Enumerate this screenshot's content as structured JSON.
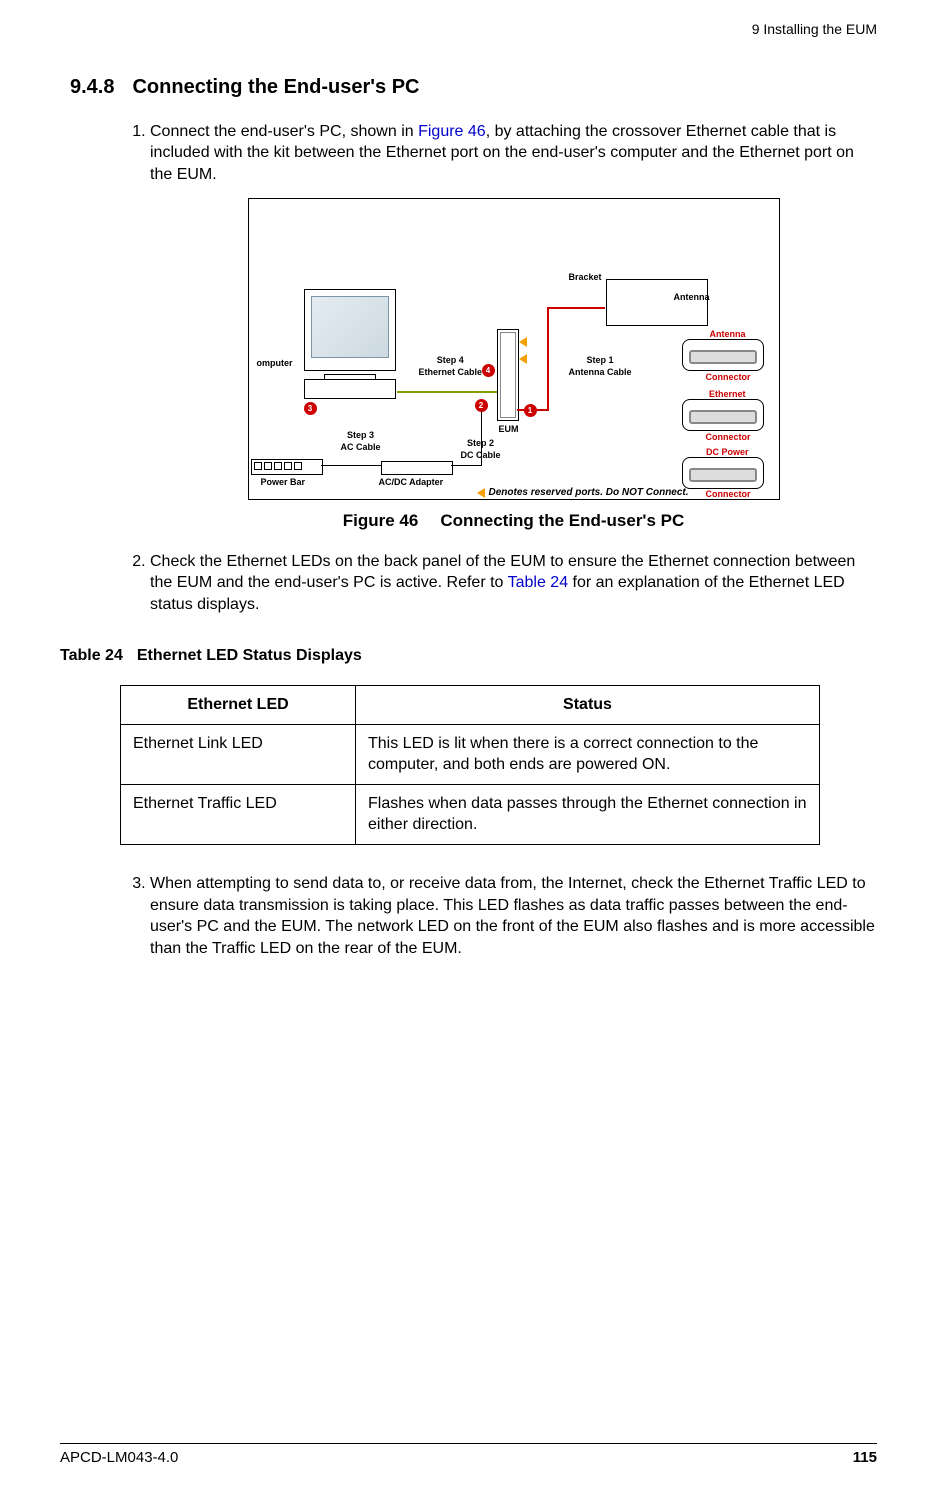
{
  "header": {
    "running": "9  Installing the EUM"
  },
  "section": {
    "number": "9.4.8",
    "title": "Connecting the End-user's PC"
  },
  "steps": {
    "s1_a": "Connect the end-user's PC, shown in ",
    "s1_link": "Figure 46",
    "s1_b": ", by attaching the crossover Ethernet cable that is included with the kit between the Ethernet port on the end-user's computer and the Ethernet port on the EUM.",
    "s2_a": "Check the Ethernet LEDs on the back panel of the EUM to ensure the Ethernet connection between the EUM and the end-user's PC is active. Refer to ",
    "s2_link": "Table 24",
    "s2_b": " for an explanation of the Ethernet LED status displays.",
    "s3": "When attempting to send data to, or receive data from, the Internet, check the Ethernet Traffic LED to ensure data transmission is taking place. This LED flashes as data traffic passes between the end-user's PC and the EUM. The network LED on the front of the EUM also flashes and is more accessible than the Traffic LED on the rear of the EUM."
  },
  "figure": {
    "num": "Figure 46",
    "title": "Connecting the End-user's PC",
    "labels": {
      "computer": "omputer",
      "powerbar": "Power Bar",
      "step3a": "Step 3",
      "step3b": "AC Cable",
      "adapter": "AC/DC Adapter",
      "step2a": "Step 2",
      "step2b": "DC Cable",
      "step4a": "Step 4",
      "step4b": "Ethernet Cable",
      "eum": "EUM",
      "step1a": "Step 1",
      "step1b": "Antenna Cable",
      "bracket": "Bracket",
      "antenna": "Antenna",
      "conn_ant_a": "Antenna",
      "conn_ant_b": "Connector",
      "conn_eth_a": "Ethernet",
      "conn_eth_b": "Connector",
      "conn_dc_a": "DC Power",
      "conn_dc_b": "Connector",
      "note": "Denotes reserved ports. Do NOT Connect.",
      "c1": "1",
      "c2": "2",
      "c3": "3",
      "c4": "4"
    }
  },
  "table": {
    "num": "Table 24",
    "title": "Ethernet LED Status Displays",
    "headers": {
      "c1": "Ethernet LED",
      "c2": "Status"
    },
    "rows": [
      {
        "led": "Ethernet Link LED",
        "status": "This LED is lit when there is a correct connection to the computer, and both ends are powered ON."
      },
      {
        "led": "Ethernet Traffic LED",
        "status": "Flashes when data passes through the Ethernet connection in either direction."
      }
    ]
  },
  "footer": {
    "doc": "APCD-LM043-4.0",
    "page": "115"
  }
}
